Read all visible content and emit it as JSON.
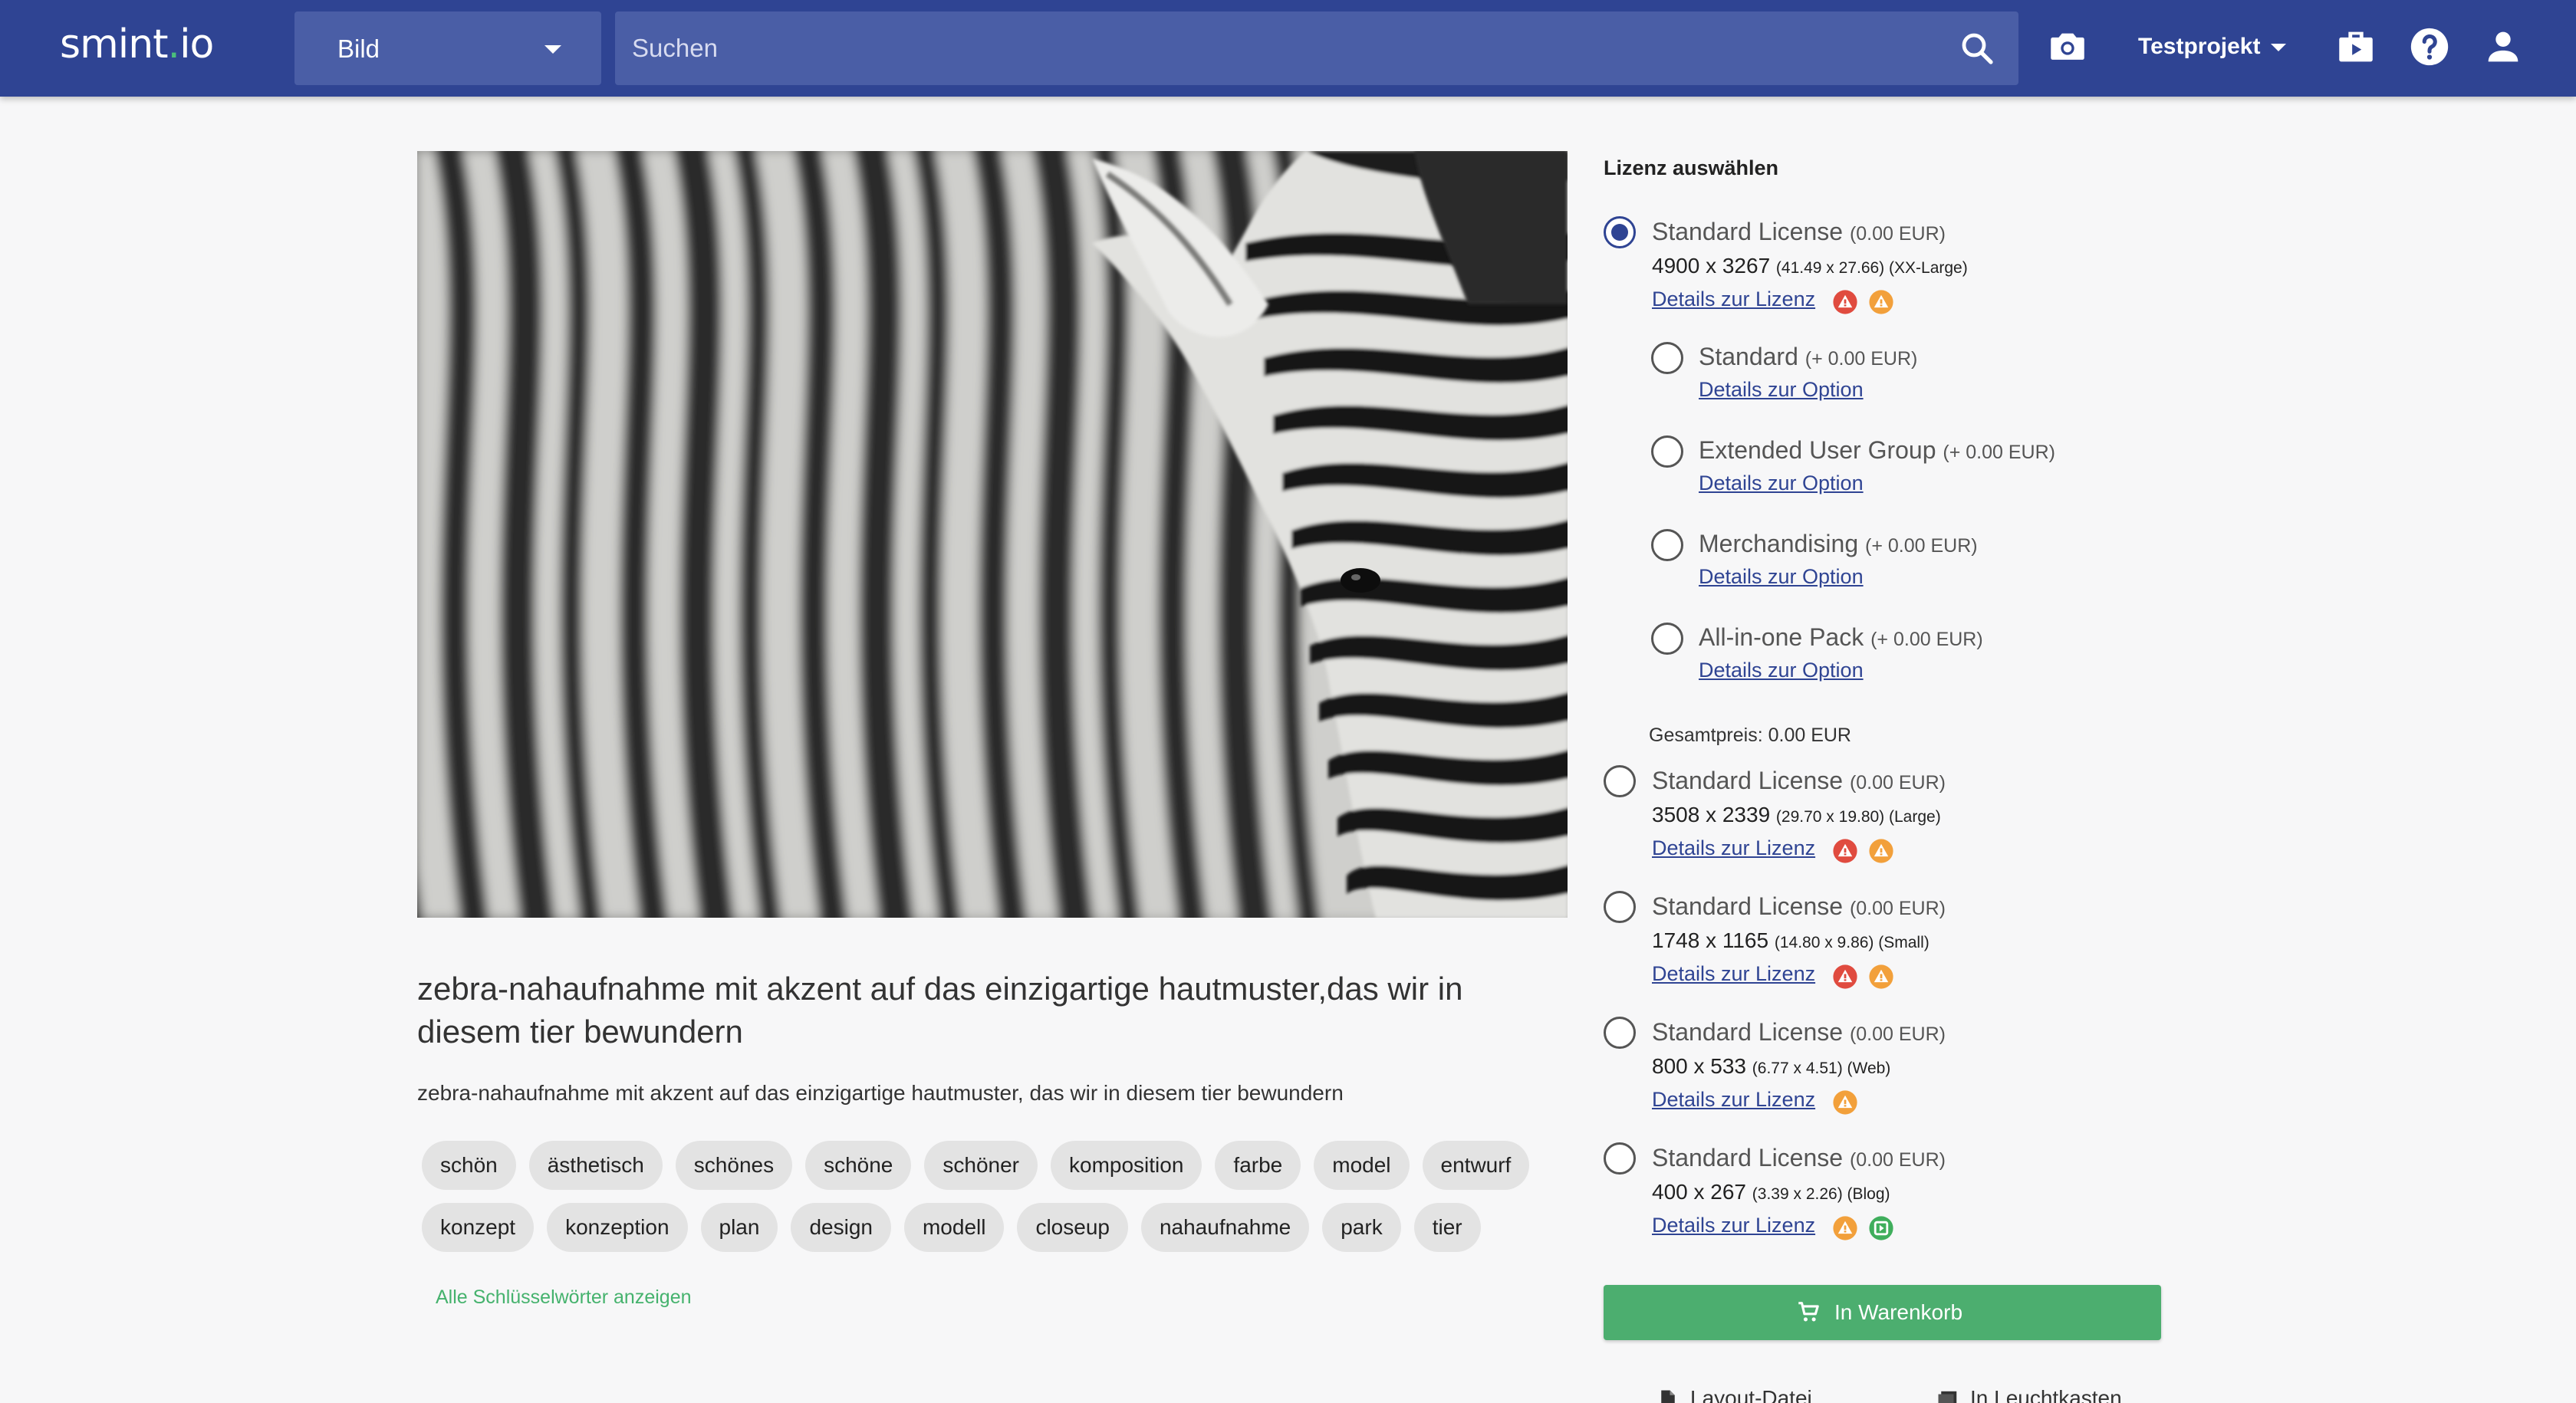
{
  "header": {
    "logo_text": "smint",
    "logo_dot": ".",
    "logo_suffix": "io",
    "type_select": "Bild",
    "search_placeholder": "Suchen",
    "project": "Testprojekt"
  },
  "asset": {
    "title": "zebra-nahaufnahme mit akzent auf das einzigartige hautmuster,das wir in diesem tier bewundern",
    "description": "zebra-nahaufnahme mit akzent auf das einzigartige hautmuster, das wir in diesem tier bewundern",
    "tags_row1": [
      "schön",
      "ästhetisch",
      "schönes",
      "schöne",
      "schöner",
      "komposition",
      "farbe",
      "model",
      "entwurf"
    ],
    "tags_row2": [
      "konzept",
      "konzeption",
      "plan",
      "design",
      "modell",
      "closeup",
      "nahaufnahme",
      "park",
      "tier"
    ],
    "more_keywords": "Alle Schlüsselwörter anzeigen"
  },
  "license_panel": {
    "title": "Lizenz auswählen",
    "licenses": [
      {
        "name": "Standard License",
        "price": "(0.00 EUR)",
        "pixels": "4900 x 3267",
        "size_detail": "(41.49 x 27.66) (XX-Large)",
        "link": "Details zur Lizenz",
        "selected": true
      },
      {
        "name": "Standard License",
        "price": "(0.00 EUR)",
        "pixels": "3508 x 2339",
        "size_detail": "(29.70 x 19.80) (Large)",
        "link": "Details zur Lizenz",
        "selected": false
      },
      {
        "name": "Standard License",
        "price": "(0.00 EUR)",
        "pixels": "1748 x 1165",
        "size_detail": "(14.80 x 9.86) (Small)",
        "link": "Details zur Lizenz",
        "selected": false
      },
      {
        "name": "Standard License",
        "price": "(0.00 EUR)",
        "pixels": "800 x 533",
        "size_detail": "(6.77 x 4.51) (Web)",
        "link": "Details zur Lizenz",
        "selected": false
      },
      {
        "name": "Standard License",
        "price": "(0.00 EUR)",
        "pixels": "400 x 267",
        "size_detail": "(3.39 x 2.26) (Blog)",
        "link": "Details zur Lizenz",
        "selected": false
      }
    ],
    "options": [
      {
        "name": "Standard",
        "price": "(+ 0.00 EUR)",
        "link": "Details zur Option"
      },
      {
        "name": "Extended User Group",
        "price": "(+ 0.00 EUR)",
        "link": "Details zur Option"
      },
      {
        "name": "Merchandising",
        "price": "(+ 0.00 EUR)",
        "link": "Details zur Option"
      },
      {
        "name": "All-in-one Pack",
        "price": "(+ 0.00 EUR)",
        "link": "Details zur Option"
      }
    ],
    "total": "Gesamtpreis: 0.00 EUR",
    "cart_button": "In Warenkorb",
    "bottom_link_1": "Layout-Datei",
    "bottom_link_2": "In Leuchtkasten"
  },
  "colors": {
    "header": "#2f4493",
    "accent_green": "#4cae6f",
    "warning_red": "#e04b3f",
    "warning_orange": "#f2a03b",
    "ok_green": "#3fae5c"
  }
}
